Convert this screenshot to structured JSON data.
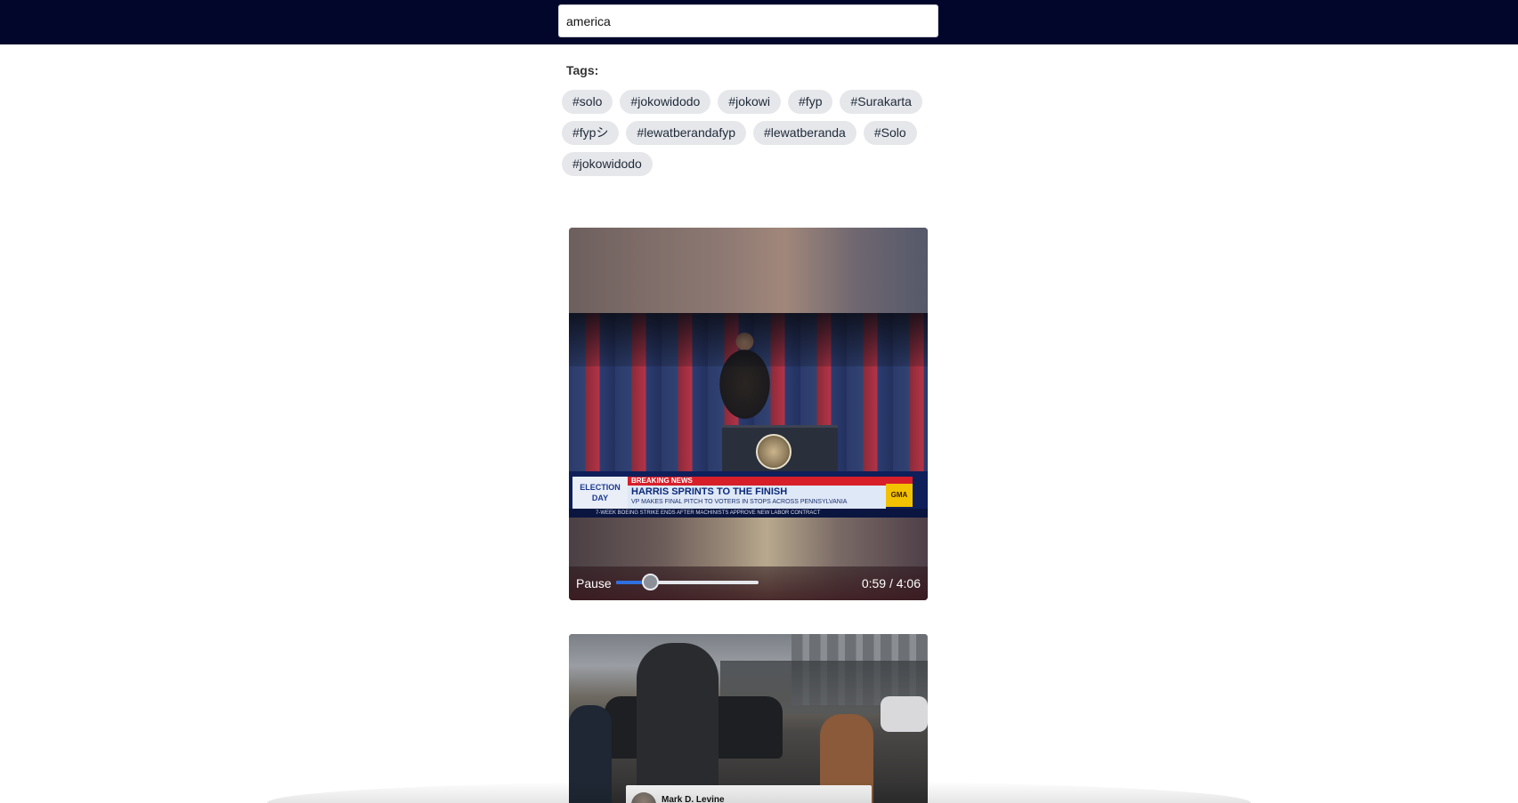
{
  "search": {
    "value": "america"
  },
  "tags": {
    "label": "Tags:",
    "items": [
      "#solo",
      "#jokowidodo",
      "#jokowi",
      "#fyp",
      "#Surakarta",
      "#fypシ",
      "#lewatberandafyp",
      "#lewatberanda",
      "#Solo",
      "#jokowidodo"
    ]
  },
  "videos": [
    {
      "overlay": {
        "logo": "ELECTION DAY",
        "breaking": "BREAKING NEWS",
        "headline": "HARRIS SPRINTS TO THE FINISH",
        "subheadline": "VP MAKES FINAL PITCH TO VOTERS IN STOPS ACROSS PENNSYLVANIA",
        "badge": "GMA",
        "ticker": "7-WEEK BOEING STRIKE ENDS AFTER MACHINISTS APPROVE NEW LABOR CONTRACT"
      },
      "controls": {
        "pause_label": "Pause",
        "time": "0:59 / 4:06",
        "progress": 0.24
      }
    },
    {
      "overlay": {
        "name": "Mark D. Levine"
      }
    }
  ],
  "colors": {
    "topbar": "#03062b",
    "tag_bg": "#e5e7eb",
    "progress_fill": "#2f6fe0"
  }
}
